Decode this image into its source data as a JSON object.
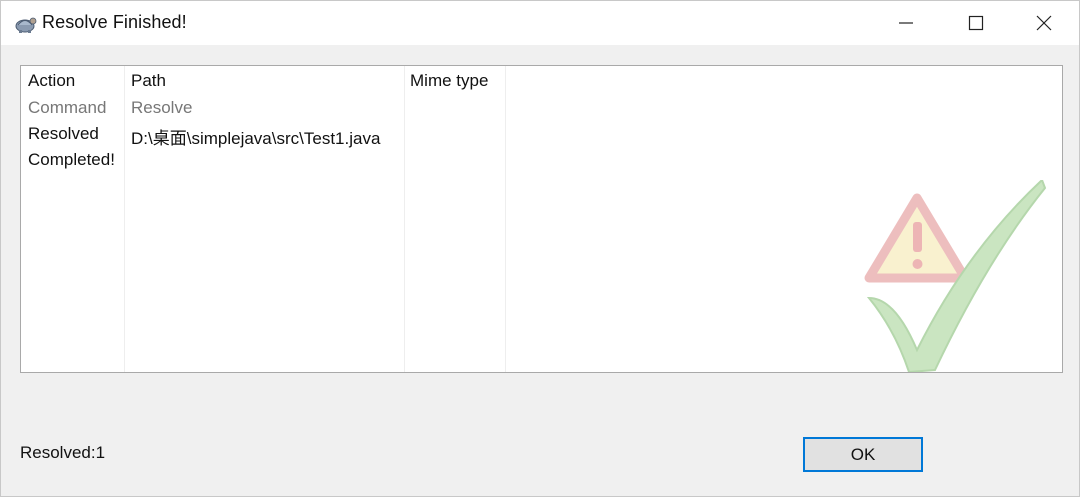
{
  "window": {
    "title": "Resolve Finished!",
    "icons": {
      "app": "tortoise-app-icon",
      "minimize": "minimize-icon",
      "maximize": "maximize-icon",
      "close": "close-icon"
    }
  },
  "list": {
    "columns": [
      "Action",
      "Path",
      "Mime type"
    ],
    "rows": [
      {
        "action": "Command",
        "path": "Resolve",
        "mime": "",
        "style": "gray"
      },
      {
        "action": "Resolved",
        "path": "D:\\桌面\\simplejava\\src\\Test1.java",
        "mime": "",
        "style": "normal"
      },
      {
        "action": "Completed!",
        "path": "",
        "mime": "",
        "style": "normal"
      }
    ]
  },
  "status": {
    "text": "Resolved:1"
  },
  "buttons": {
    "ok": "OK"
  },
  "colors": {
    "accent": "#0078d7",
    "dialog_bg": "#f0f0f0",
    "gray_text": "#777777"
  }
}
